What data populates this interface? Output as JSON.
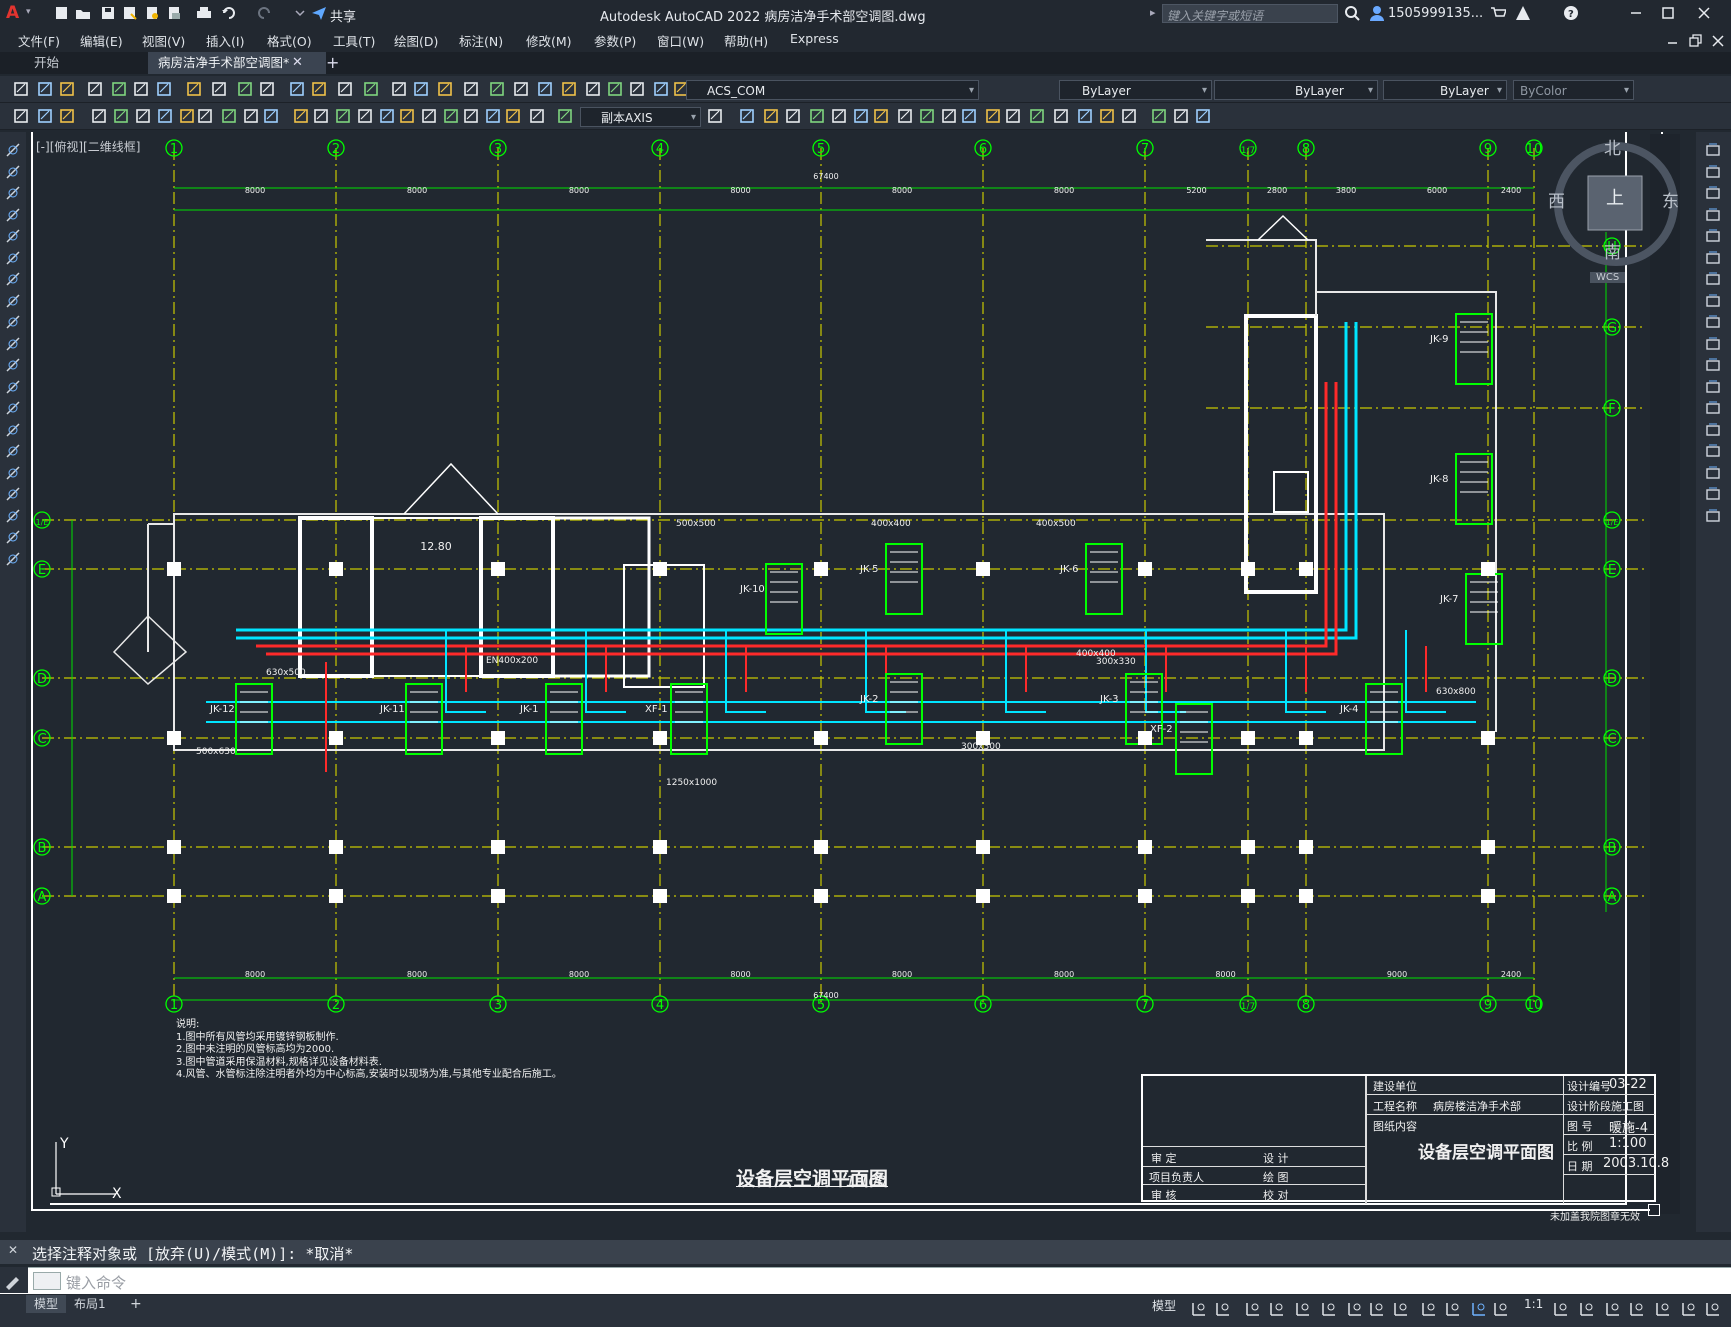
{
  "app": {
    "title": "Autodesk AutoCAD 2022    病房洁净手术部空调图.dwg",
    "share_label": "共享",
    "search_placeholder": "键入关键字或短语",
    "user": "1505999135...",
    "logo": "A"
  },
  "menu": [
    "文件(F)",
    "编辑(E)",
    "视图(V)",
    "插入(I)",
    "格式(O)",
    "工具(T)",
    "绘图(D)",
    "标注(N)",
    "修改(M)",
    "参数(P)",
    "窗口(W)",
    "帮助(H)",
    "Express"
  ],
  "tabs": {
    "start": "开始",
    "active": "病房洁净手术部空调图*",
    "add": "+"
  },
  "toolbar": {
    "layer": "ACS_COM",
    "color": "ByLayer",
    "linetype": "ByLayer",
    "lineweight": "ByLayer",
    "plotstyle": "ByColor",
    "dimstyle": "副本AXIS"
  },
  "viewport": {
    "label": "[-][俯视][二维线框]"
  },
  "viewcube": {
    "north": "北",
    "south": "南",
    "east": "东",
    "west": "西",
    "top": "上",
    "wcs": "WCS"
  },
  "drawing": {
    "col_labels": [
      "1",
      "2",
      "3",
      "4",
      "5",
      "6",
      "7",
      "1/7",
      "8",
      "9",
      "10"
    ],
    "row_labels": [
      "A",
      "B",
      "C",
      "D",
      "E",
      "1/E",
      "F",
      "G",
      "H"
    ],
    "top_dims": [
      "8000",
      "8000",
      "8000",
      "8000",
      "8000",
      "8000",
      "5200",
      "2800",
      "3800",
      "6000",
      "2400"
    ],
    "total_dim": "67400",
    "bottom_dims": [
      "8000",
      "8000",
      "8000",
      "8000",
      "8000",
      "8000",
      "8000",
      "9000",
      "2400"
    ],
    "title": "设备层空调平面图",
    "scale": "1:100",
    "units": [
      "JK-1",
      "JK-2",
      "JK-3",
      "JK-4",
      "JK-5",
      "JK-6",
      "JK-7",
      "JK-8",
      "JK-9",
      "JK-10",
      "JK-11",
      "JK-12",
      "XF-1",
      "XF-2"
    ],
    "ducts": [
      "500x500",
      "400x400",
      "400x500",
      "630x500",
      "500x630",
      "400x400",
      "630x800",
      "300x300",
      "1250x1000",
      "EN400x200",
      "300x330"
    ],
    "notes": [
      "说明:",
      "1.图中所有风管均采用镀锌钢板制作.",
      "2.图中未注明的风管标高均为2000.",
      "3.图中管道采用保温材料,规格详见设备材料表.",
      "4.风管、水管标注除注明者外均为中心标高,安装时以现场为准,与其他专业配合后施工。"
    ],
    "title_block": {
      "design_unit": "建设单位",
      "project_name": "工程名称",
      "project": "病房楼洁净手术部",
      "drawing_content": "图纸内容",
      "content": "设备层空调平面图",
      "design_no_label": "设计编号",
      "design_no": "03-22",
      "stage_label": "设计阶段",
      "stage": "施工图",
      "drawing_no_label": "图 号",
      "drawing_no": "暖施-4",
      "scale_label": "比 例",
      "scale": "1:100",
      "date_label": "日 期",
      "date": "2003.10.8",
      "review": "审 定",
      "design": "设 计",
      "project_lead": "项目负责人",
      "drawn": "绘 图",
      "check": "审 核",
      "verify": "校 对",
      "stamp": "未加盖我院图章无效"
    },
    "elev": "12.80",
    "ucs_y": "Y",
    "ucs_x": "X"
  },
  "command": {
    "history": "选择注释对象或 [放弃(U)/模式(M)]: *取消*",
    "placeholder": "键入命令"
  },
  "status": {
    "model_tab": "模型",
    "layout_tab": "布局1",
    "add": "+",
    "model_space": "模型",
    "annoscale": "1:1"
  },
  "colors": {
    "background": "#212830",
    "grid": "#00ff00",
    "axis": "#ffff00",
    "duct_supply": "#00ffff",
    "duct_return": "#ff2020",
    "walls": "#ffffff"
  }
}
